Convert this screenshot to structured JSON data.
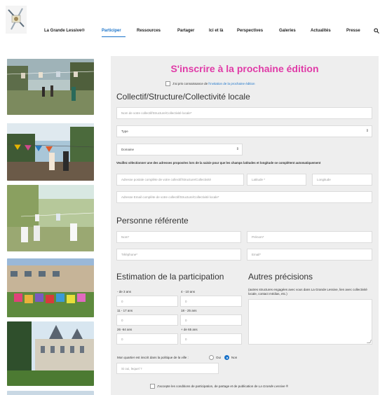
{
  "nav": {
    "items": [
      {
        "label": "La Grande Lessive®"
      },
      {
        "label": "Participer"
      },
      {
        "label": "Ressources"
      },
      {
        "label": "Partager"
      },
      {
        "label": "Ici et là"
      },
      {
        "label": "Perspectives"
      },
      {
        "label": "Galeries"
      },
      {
        "label": "Actualités"
      },
      {
        "label": "Presse"
      }
    ],
    "active_index": 1,
    "search_icon": "search-icon",
    "accent_color": "#1a73c9"
  },
  "form": {
    "title": "S'inscrire à la prochaine édition",
    "title_color": "#e03aa7",
    "invitation": {
      "prefix": "J'ai pris connaissance de ",
      "link": "l'invitation de la prochaine édition"
    },
    "collectif": {
      "heading": "Collectif/Structure/Collectivité locale",
      "name_placeholder": "Nom de votre collectif/Structure/Collectivité locale*",
      "type_value": "Type",
      "domaine_value": "Domaine",
      "address_instruction": "Veuillez sélectionner une des adresses proposées lors de la saisie pour que les champs latitudes et longitude se complètent automatiquement",
      "address_placeholder": "Adresse postale complète de votre collectif/Structure/Collectivité",
      "latitude_placeholder": "Latitude *",
      "longitude_placeholder": "Longitude",
      "email_placeholder": "Adresse Email complète de votre collectif/Structure/Collectivité locale*"
    },
    "referent": {
      "heading": "Personne référente",
      "nom_placeholder": "Nom*",
      "prenom_placeholder": "Prénom*",
      "telephone_placeholder": "Téléphone*",
      "email_placeholder": "Email*"
    },
    "estimation": {
      "heading": "Estimation de la participation",
      "groups": [
        {
          "label": "- de 3 ans",
          "value": "0"
        },
        {
          "label": "4 - 10 ans",
          "value": "0"
        },
        {
          "label": "11 - 17 ans",
          "value": "0"
        },
        {
          "label": "18 - 25 ans",
          "value": "0"
        },
        {
          "label": "26 -64 ans",
          "value": "0"
        },
        {
          "label": "+ de 65 ans",
          "value": "0"
        }
      ]
    },
    "precisions": {
      "heading": "Autres précisions",
      "note": "(autres structures engagées avec vous dans La Grande Lessive, lien avec collectivité locale, contact médias, etc.)"
    },
    "quartier": {
      "question": "Mon quartier est inscrit dans la politique de la ville :",
      "oui": "Oui",
      "non": "Non",
      "selected": "Non",
      "lequel_placeholder": "Si oui, lequel ?"
    },
    "conditions": {
      "prefix": "J'accepte les conditions de participation, de partage et de publication de ",
      "brand": "La Grande Lessive ®"
    }
  }
}
